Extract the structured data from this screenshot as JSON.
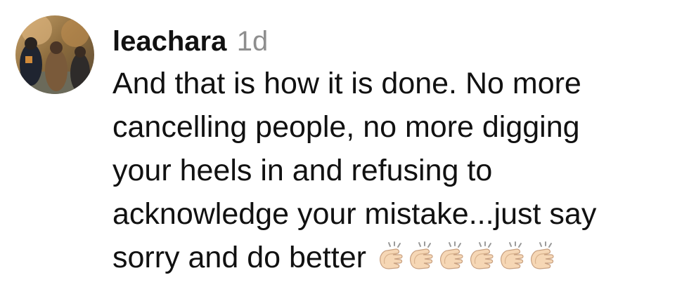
{
  "comment": {
    "username": "leachara",
    "timestamp": "1d",
    "lines": [
      "And that is how it is done. No more",
      "cancelling people, no more digging",
      "your heels in and refusing to",
      "acknowledge your mistake...just say",
      "sorry and do better"
    ],
    "emoji": [
      "clapping-hands",
      "clapping-hands",
      "clapping-hands",
      "clapping-hands",
      "clapping-hands",
      "clapping-hands"
    ],
    "colors": {
      "username": "#111111",
      "timestamp": "#8e8e8e",
      "text": "#111111",
      "clap_skin": "#f6d7b5"
    }
  }
}
